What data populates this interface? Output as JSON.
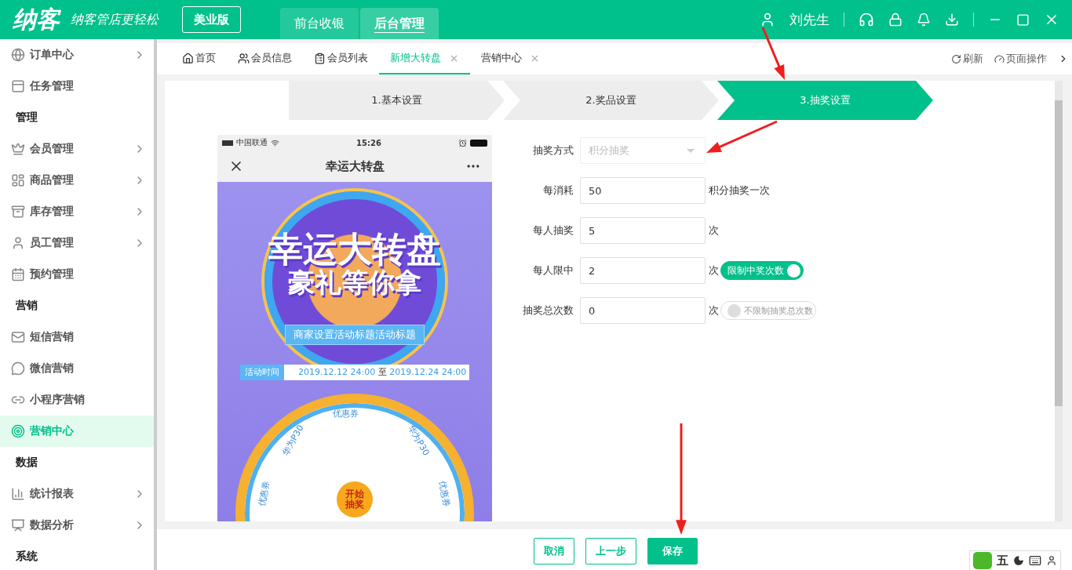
{
  "header": {
    "logo": "纳客",
    "slogan": "纳客管店更轻松",
    "edition": "美业版",
    "nav": [
      {
        "label": "前台收银",
        "selected": false
      },
      {
        "label": "后台管理",
        "selected": true
      }
    ],
    "user": "刘先生"
  },
  "sidebar": [
    {
      "kind": "item",
      "label": "订单中心",
      "submenu": true,
      "selected": false
    },
    {
      "kind": "item",
      "label": "任务管理",
      "submenu": false,
      "selected": false
    },
    {
      "kind": "section",
      "label": "管理"
    },
    {
      "kind": "item",
      "label": "会员管理",
      "submenu": true,
      "selected": false
    },
    {
      "kind": "item",
      "label": "商品管理",
      "submenu": true,
      "selected": false
    },
    {
      "kind": "item",
      "label": "库存管理",
      "submenu": true,
      "selected": false
    },
    {
      "kind": "item",
      "label": "员工管理",
      "submenu": true,
      "selected": false
    },
    {
      "kind": "item",
      "label": "预约管理",
      "submenu": false,
      "selected": false
    },
    {
      "kind": "section",
      "label": "营销"
    },
    {
      "kind": "item",
      "label": "短信营销",
      "submenu": false,
      "selected": false
    },
    {
      "kind": "item",
      "label": "微信营销",
      "submenu": false,
      "selected": false
    },
    {
      "kind": "item",
      "label": "小程序营销",
      "submenu": false,
      "selected": false
    },
    {
      "kind": "item",
      "label": "营销中心",
      "submenu": false,
      "selected": true
    },
    {
      "kind": "section",
      "label": "数据"
    },
    {
      "kind": "item",
      "label": "统计报表",
      "submenu": true,
      "selected": false
    },
    {
      "kind": "item",
      "label": "数据分析",
      "submenu": true,
      "selected": false
    },
    {
      "kind": "section",
      "label": "系统"
    }
  ],
  "tabs": [
    {
      "label": "首页",
      "selected": false,
      "closable": false
    },
    {
      "label": "会员信息",
      "selected": false,
      "closable": false
    },
    {
      "label": "会员列表",
      "selected": false,
      "closable": false
    },
    {
      "label": "新增大转盘",
      "selected": true,
      "closable": true
    },
    {
      "label": "营销中心",
      "selected": false,
      "closable": true
    }
  ],
  "tab_tools": [
    "刷新",
    "页面操作"
  ],
  "steps": [
    {
      "label": "1.基本设置",
      "selected": false
    },
    {
      "label": "2.奖品设置",
      "selected": false
    },
    {
      "label": "3.抽奖设置",
      "selected": true
    }
  ],
  "phone": {
    "carrier": "中国联通",
    "time": "15:26",
    "title": "幸运大转盘",
    "headline": [
      "幸运大转盘",
      "豪礼等你拿"
    ],
    "banner": "商家设置活动标题活动标题",
    "time_label": "活动时间",
    "date_start": "2019.12.12 24:00",
    "date_sep": "至",
    "date_end": "2019.12.24 24:00",
    "segments": [
      "优惠券",
      "华为P30",
      "华为P30",
      "优惠券",
      "优惠券"
    ],
    "start": [
      "开始",
      "抽奖"
    ]
  },
  "form": [
    {
      "kind": "select",
      "label": "抽奖方式",
      "value": "积分抽奖",
      "disabled": true
    },
    {
      "kind": "input",
      "label": "每消耗",
      "value": "50",
      "suffix": "积分抽奖一次"
    },
    {
      "kind": "input",
      "label": "每人抽奖",
      "value": "5",
      "suffix": "次"
    },
    {
      "kind": "input",
      "label": "每人限中",
      "value": "2",
      "suffix": "次",
      "toggle": {
        "label": "限制中奖次数",
        "on": true
      }
    },
    {
      "kind": "input",
      "label": "抽奖总次数",
      "value": "0",
      "suffix": "次",
      "toggle": {
        "label": "不限制抽奖总次数",
        "on": false
      }
    }
  ],
  "buttons": [
    {
      "label": "取消",
      "kind": "outline"
    },
    {
      "label": "上一步",
      "kind": "outline"
    },
    {
      "label": "保存",
      "kind": "primary"
    }
  ],
  "ime": "五"
}
